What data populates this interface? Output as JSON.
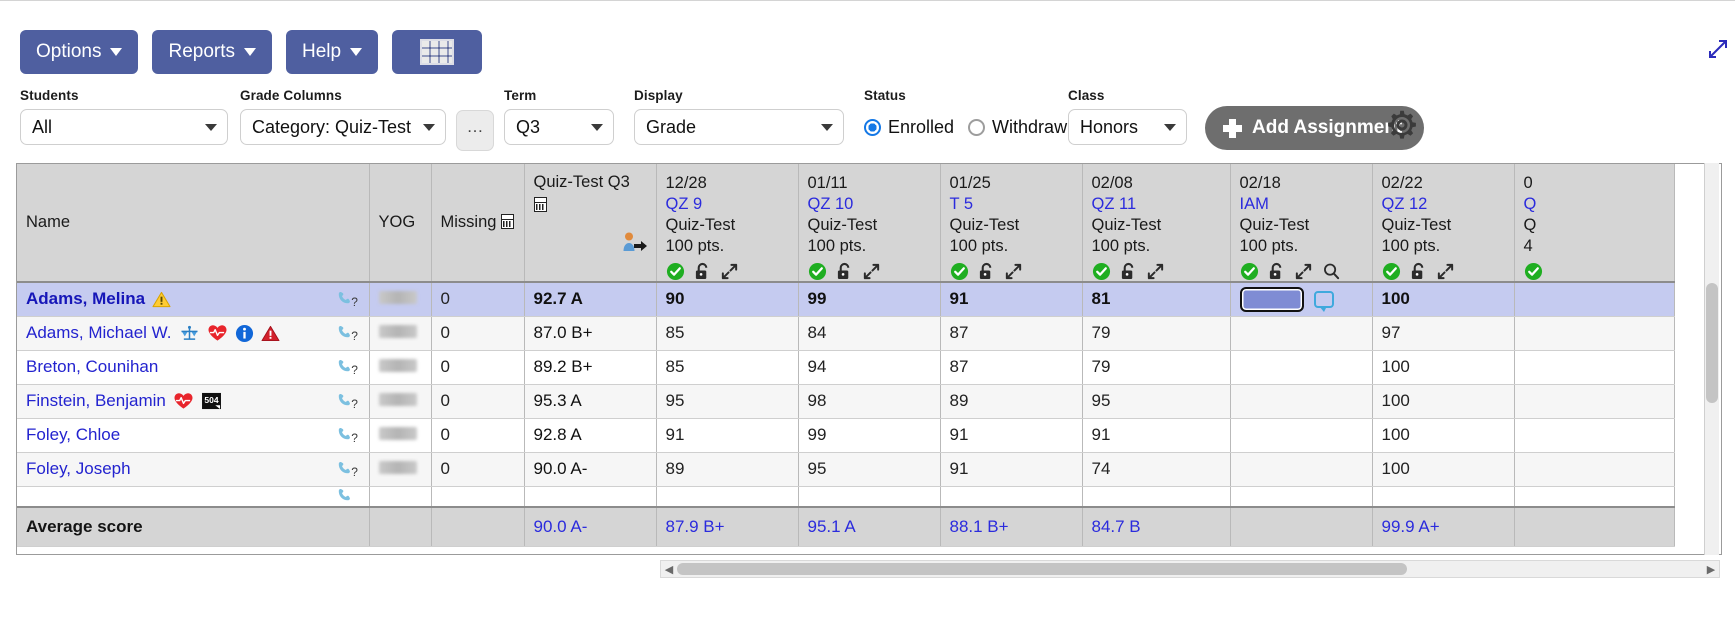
{
  "toolbar": {
    "buttons": [
      {
        "label": "Options",
        "icon": "chevron-down-icon"
      },
      {
        "label": "Reports",
        "icon": "chevron-down-icon"
      },
      {
        "label": "Help",
        "icon": "chevron-down-icon"
      }
    ],
    "grid_view_icon": "grid-table-icon",
    "expand_corner_icon": "expand-window-icon",
    "accent_color": "#4f5fa0"
  },
  "filters": {
    "students": {
      "label": "Students",
      "value": "All"
    },
    "grade_columns": {
      "label": "Grade Columns",
      "value": "Category: Quiz-Test"
    },
    "more_button": {
      "label": "…"
    },
    "term": {
      "label": "Term",
      "value": "Q3"
    },
    "display": {
      "label": "Display",
      "value": "Grade"
    },
    "status": {
      "label": "Status",
      "options": [
        {
          "label": "Enrolled",
          "selected": true
        },
        {
          "label": "Withdrawn",
          "selected": false
        }
      ],
      "radio_color": "#1478e6"
    },
    "class": {
      "label": "Class",
      "value": "Honors"
    },
    "add_assignment": {
      "label": "Add Assignment",
      "icon": "plus-icon",
      "color": "#6e6e6e"
    },
    "settings": {
      "icon": "gear-icon"
    }
  },
  "grid": {
    "fixed_headers": {
      "name": "Name",
      "yog": "YOG",
      "missing": "Missing",
      "missing_icon": "calculator-icon",
      "category_total": {
        "title": "Quiz-Test Q3",
        "calc_icon": "calculator-icon",
        "post_icon": "post-grades-icon"
      }
    },
    "assignment_columns": [
      {
        "date": "12/28",
        "code": "QZ 9",
        "category": "Quiz-Test",
        "points": "100 pts.",
        "icons": [
          "check-circle-icon",
          "unlock-icon",
          "expand-arrows-icon"
        ]
      },
      {
        "date": "01/11",
        "code": "QZ 10",
        "category": "Quiz-Test",
        "points": "100 pts.",
        "icons": [
          "check-circle-icon",
          "unlock-icon",
          "expand-arrows-icon"
        ]
      },
      {
        "date": "01/25",
        "code": "T 5",
        "category": "Quiz-Test",
        "points": "100 pts.",
        "icons": [
          "check-circle-icon",
          "unlock-icon",
          "expand-arrows-icon"
        ]
      },
      {
        "date": "02/08",
        "code": "QZ 11",
        "category": "Quiz-Test",
        "points": "100 pts.",
        "icons": [
          "check-circle-icon",
          "unlock-icon",
          "expand-arrows-icon"
        ]
      },
      {
        "date": "02/18",
        "code": "IAM",
        "category": "Quiz-Test",
        "points": "100 pts.",
        "icons": [
          "check-circle-icon",
          "unlock-icon",
          "expand-arrows-icon",
          "search-icon"
        ]
      },
      {
        "date": "02/22",
        "code": "QZ 12",
        "category": "Quiz-Test",
        "points": "100 pts.",
        "icons": [
          "check-circle-icon",
          "unlock-icon",
          "expand-arrows-icon"
        ]
      }
    ],
    "rows": [
      {
        "name": "Adams, Melina",
        "icons": [
          "warning-triangle-yellow-icon"
        ],
        "contact_icon": "phone-question-icon",
        "yog": "",
        "missing": "0",
        "category_grade": "92.7 A",
        "scores": [
          "90",
          "99",
          "91",
          "81",
          "",
          "100"
        ],
        "selected": true,
        "editing_column": 4,
        "editing_value": "",
        "comment_icon": "comment-bubble-icon"
      },
      {
        "name": "Adams, Michael W.",
        "icons": [
          "legal-scales-icon",
          "health-heart-icon",
          "info-circle-icon",
          "alert-triangle-red-icon"
        ],
        "contact_icon": "phone-question-icon",
        "yog": "",
        "missing": "0",
        "category_grade": "87.0 B+",
        "scores": [
          "85",
          "84",
          "87",
          "79",
          "",
          "97"
        ],
        "selected": false
      },
      {
        "name": "Breton, Counihan",
        "icons": [],
        "contact_icon": "phone-question-icon",
        "yog": "",
        "missing": "0",
        "category_grade": "89.2 B+",
        "scores": [
          "85",
          "94",
          "87",
          "79",
          "",
          "100"
        ],
        "selected": false
      },
      {
        "name": "Finstein, Benjamin",
        "icons": [
          "health-heart-icon",
          "section-504-icon"
        ],
        "contact_icon": "phone-question-icon",
        "yog": "",
        "missing": "0",
        "category_grade": "95.3 A",
        "scores": [
          "95",
          "98",
          "89",
          "95",
          "",
          "100"
        ],
        "selected": false
      },
      {
        "name": "Foley, Chloe",
        "icons": [],
        "contact_icon": "phone-question-icon",
        "yog": "",
        "missing": "0",
        "category_grade": "92.8 A",
        "scores": [
          "91",
          "99",
          "91",
          "91",
          "",
          "100"
        ],
        "selected": false
      },
      {
        "name": "Foley, Joseph",
        "icons": [],
        "contact_icon": "phone-question-icon",
        "yog": "",
        "missing": "0",
        "category_grade": "90.0 A-",
        "scores": [
          "89",
          "95",
          "91",
          "74",
          "",
          "100"
        ],
        "selected": false
      }
    ],
    "footer": {
      "label": "Average score",
      "category_average": "90.0 A-",
      "averages": [
        "87.9 B+",
        "95.1 A",
        "88.1 B+",
        "84.7 B",
        "",
        "99.9 A+"
      ]
    }
  },
  "scrollbars": {
    "horizontal": {
      "left_arrow": "◀",
      "right_arrow": "▶"
    }
  }
}
